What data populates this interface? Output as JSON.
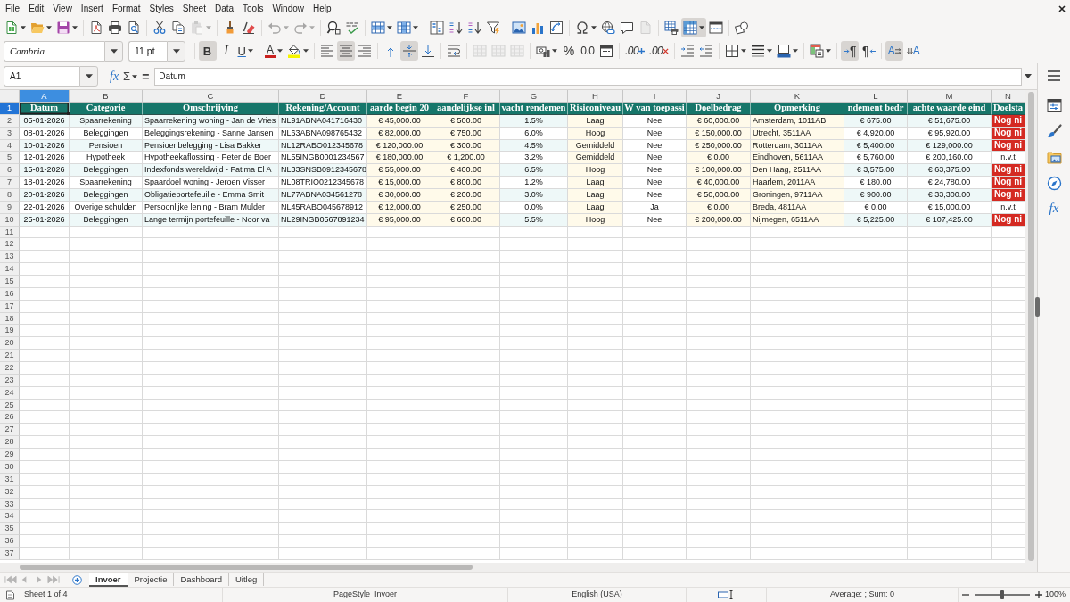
{
  "menu_bar": [
    "File",
    "Edit",
    "View",
    "Insert",
    "Format",
    "Styles",
    "Sheet",
    "Data",
    "Tools",
    "Window",
    "Help"
  ],
  "standard_toolbar": [
    {
      "pressed": false,
      "disabled": false
    },
    {
      "pressed": false,
      "disabled": false
    },
    {
      "pressed": false,
      "disabled": false
    },
    {
      "pressed": false,
      "disabled": false
    },
    {
      "pressed": false,
      "disabled": false
    },
    {
      "pressed": false,
      "disabled": false
    },
    {
      "pressed": false,
      "disabled": false
    },
    {
      "pressed": false,
      "disabled": false
    },
    {
      "pressed": false,
      "disabled": true
    },
    {
      "pressed": false,
      "disabled": false
    },
    {
      "pressed": false,
      "disabled": false
    },
    {
      "pressed": false,
      "disabled": true
    },
    {
      "pressed": false,
      "disabled": true
    },
    {
      "pressed": false,
      "disabled": false
    },
    {
      "pressed": false,
      "disabled": false
    },
    {
      "pressed": false,
      "disabled": false
    },
    {
      "pressed": false,
      "disabled": false
    },
    {
      "pressed": false,
      "disabled": false
    },
    {
      "pressed": false,
      "disabled": false
    },
    {
      "pressed": false,
      "disabled": false
    },
    {
      "pressed": false,
      "disabled": false
    },
    {
      "pressed": false,
      "disabled": false
    },
    {
      "pressed": false,
      "disabled": false
    },
    {
      "pressed": false,
      "disabled": false
    },
    {
      "pressed": false,
      "disabled": false
    },
    {
      "pressed": false,
      "disabled": false
    },
    {
      "pressed": false,
      "disabled": false
    },
    {
      "pressed": false,
      "disabled": true
    },
    {
      "pressed": false,
      "disabled": false
    },
    {
      "pressed": true,
      "disabled": false
    },
    {
      "pressed": false,
      "disabled": false
    },
    {
      "pressed": false,
      "disabled": false
    }
  ],
  "formatting_toolbar": {
    "font_name": "Cambria",
    "font_size": "11 pt",
    "buttons": [
      {
        "label": "B",
        "pressed": true,
        "disabled": false
      },
      {
        "label": "I",
        "pressed": false,
        "disabled": false
      },
      {
        "label": "U",
        "pressed": false,
        "disabled": false
      },
      {
        "label": "A",
        "pressed": false,
        "disabled": false
      },
      {
        "pressed": false,
        "disabled": false
      },
      {
        "pressed": false,
        "disabled": false
      },
      {
        "pressed": true,
        "disabled": false
      },
      {
        "pressed": false,
        "disabled": false
      },
      {
        "pressed": false,
        "disabled": false
      },
      {
        "pressed": true,
        "disabled": false
      },
      {
        "pressed": false,
        "disabled": false
      },
      {
        "pressed": false,
        "disabled": false
      },
      {
        "pressed": false,
        "disabled": true
      },
      {
        "pressed": false,
        "disabled": true
      },
      {
        "pressed": false,
        "disabled": true
      },
      {
        "pressed": false,
        "disabled": false
      },
      {
        "label": "%",
        "pressed": false,
        "disabled": false
      },
      {
        "label": "0.0",
        "pressed": false,
        "disabled": false
      },
      {
        "pressed": false,
        "disabled": false
      },
      {
        "label": ".00",
        "pressed": false,
        "disabled": false
      },
      {
        "label": ".00",
        "pressed": false,
        "disabled": false
      },
      {
        "pressed": false,
        "disabled": false
      },
      {
        "pressed": false,
        "disabled": false
      },
      {
        "pressed": false,
        "disabled": false
      },
      {
        "pressed": false,
        "disabled": false
      },
      {
        "pressed": false,
        "disabled": false
      },
      {
        "pressed": false,
        "disabled": false
      },
      {
        "label": "¶",
        "pressed": true,
        "disabled": false
      },
      {
        "label": "¶",
        "pressed": false,
        "disabled": false
      },
      {
        "label": "A",
        "pressed": true,
        "disabled": false
      },
      {
        "label": "A",
        "pressed": false,
        "disabled": false
      }
    ]
  },
  "formula_bar": {
    "cell_reference": "A1",
    "function_wizard": "fx",
    "sum_symbol": "Σ",
    "equals_symbol": "=",
    "content": "Datum"
  },
  "sidebar": {
    "functions_label": "fx"
  },
  "sheet": {
    "columns": [
      {
        "letter": "A",
        "selected": true,
        "kind": "banded"
      },
      {
        "letter": "B",
        "selected": false,
        "kind": "banded"
      },
      {
        "letter": "C",
        "selected": false,
        "kind": "banded"
      },
      {
        "letter": "D",
        "selected": false,
        "kind": "banded"
      },
      {
        "letter": "E",
        "selected": false,
        "kind": "input"
      },
      {
        "letter": "F",
        "selected": false,
        "kind": "input"
      },
      {
        "letter": "G",
        "selected": false,
        "kind": "banded"
      },
      {
        "letter": "H",
        "selected": false,
        "kind": "input"
      },
      {
        "letter": "I",
        "selected": false,
        "kind": "plain"
      },
      {
        "letter": "J",
        "selected": false,
        "kind": "input"
      },
      {
        "letter": "K",
        "selected": false,
        "kind": "input"
      },
      {
        "letter": "L",
        "selected": false,
        "kind": "banded"
      },
      {
        "letter": "M",
        "selected": false,
        "kind": "banded"
      },
      {
        "letter": "N",
        "selected": false,
        "kind": "plain"
      }
    ],
    "rows": [
      {
        "number": "1",
        "selected": true,
        "kind": "header",
        "cells": [
          "Datum",
          "Categorie",
          "Omschrijving",
          "Rekening/Account",
          "aarde begin 20",
          "aandelijkse inl",
          "vacht rendemen",
          "Risiconiveau",
          "W van toepassi",
          "Doelbedrag",
          "Opmerking",
          "ndement bedr",
          "achte waarde eind",
          "Doelsta"
        ]
      },
      {
        "number": "2",
        "selected": false,
        "kind": "data",
        "cells": [
          "05-01-2026",
          "Spaarrekening",
          "Spaarrekening woning - Jan de Vries",
          "NL91ABNA041716430",
          "€ 45,000.00",
          "€ 500.00",
          "1.5%",
          "Laag",
          "Nee",
          "€ 60,000.00",
          "Amsterdam, 1011AB",
          "€ 675.00",
          "€ 51,675.00",
          {
            "text": "Nog ni",
            "flagged": true
          }
        ]
      },
      {
        "number": "3",
        "selected": false,
        "kind": "data",
        "cells": [
          "08-01-2026",
          "Beleggingen",
          "Beleggingsrekening - Sanne Jansen",
          "NL63ABNA098765432",
          "€ 82,000.00",
          "€ 750.00",
          "6.0%",
          "Hoog",
          "Nee",
          "€ 150,000.00",
          "Utrecht, 3511AA",
          "€ 4,920.00",
          "€ 95,920.00",
          {
            "text": "Nog ni",
            "flagged": true
          }
        ]
      },
      {
        "number": "4",
        "selected": false,
        "kind": "data",
        "cells": [
          "10-01-2026",
          "Pensioen",
          "Pensioenbelegging - Lisa Bakker",
          "NL12RABO012345678",
          "€ 120,000.00",
          "€ 300.00",
          "4.5%",
          "Gemiddeld",
          "Nee",
          "€ 250,000.00",
          "Rotterdam, 3011AA",
          "€ 5,400.00",
          "€ 129,000.00",
          {
            "text": "Nog ni",
            "flagged": true
          }
        ]
      },
      {
        "number": "5",
        "selected": false,
        "kind": "data",
        "cells": [
          "12-01-2026",
          "Hypotheek",
          "Hypotheekaflossing - Peter de Boer",
          "NL55INGB0001234567",
          "€ 180,000.00",
          "€ 1,200.00",
          "3.2%",
          "Gemiddeld",
          "Nee",
          "€ 0.00",
          "Eindhoven, 5611AA",
          "€ 5,760.00",
          "€ 200,160.00",
          {
            "text": "n.v.t",
            "flagged": false
          }
        ]
      },
      {
        "number": "6",
        "selected": false,
        "kind": "data",
        "cells": [
          "15-01-2026",
          "Beleggingen",
          "Indexfonds wereldwijd - Fatima El A",
          "NL33SNSB0912345678",
          "€ 55,000.00",
          "€ 400.00",
          "6.5%",
          "Hoog",
          "Nee",
          "€ 100,000.00",
          "Den Haag, 2511AA",
          "€ 3,575.00",
          "€ 63,375.00",
          {
            "text": "Nog ni",
            "flagged": true
          }
        ]
      },
      {
        "number": "7",
        "selected": false,
        "kind": "data",
        "cells": [
          "18-01-2026",
          "Spaarrekening",
          "Spaardoel woning - Jeroen Visser",
          "NL08TRIO0212345678",
          "€ 15,000.00",
          "€ 800.00",
          "1.2%",
          "Laag",
          "Nee",
          "€ 40,000.00",
          "Haarlem, 2011AA",
          "€ 180.00",
          "€ 24,780.00",
          {
            "text": "Nog ni",
            "flagged": true
          }
        ]
      },
      {
        "number": "8",
        "selected": false,
        "kind": "data",
        "cells": [
          "20-01-2026",
          "Beleggingen",
          "Obligatieportefeuille - Emma Smit",
          "NL77ABNA034561278",
          "€ 30,000.00",
          "€ 200.00",
          "3.0%",
          "Laag",
          "Nee",
          "€ 50,000.00",
          "Groningen, 9711AA",
          "€ 900.00",
          "€ 33,300.00",
          {
            "text": "Nog ni",
            "flagged": true
          }
        ]
      },
      {
        "number": "9",
        "selected": false,
        "kind": "data",
        "cells": [
          "22-01-2026",
          "Overige schulden",
          "Persoonlijke lening - Bram Mulder",
          "NL45RABO045678912",
          "€ 12,000.00",
          "€ 250.00",
          "0.0%",
          "Laag",
          "Ja",
          "€ 0.00",
          "Breda, 4811AA",
          "€ 0.00",
          "€ 15,000.00",
          {
            "text": "n.v.t",
            "flagged": false
          }
        ]
      },
      {
        "number": "10",
        "selected": false,
        "kind": "data",
        "cells": [
          "25-01-2026",
          "Beleggingen",
          "Lange termijn portefeuille - Noor va",
          "NL29INGB0567891234",
          "€ 95,000.00",
          "€ 600.00",
          "5.5%",
          "Hoog",
          "Nee",
          "€ 200,000.00",
          "Nijmegen, 6511AA",
          "€ 5,225.00",
          "€ 107,425.00",
          {
            "text": "Nog ni",
            "flagged": true
          }
        ]
      },
      {
        "number": "11",
        "selected": false,
        "kind": "blank"
      },
      {
        "number": "12",
        "selected": false,
        "kind": "blank"
      },
      {
        "number": "13",
        "selected": false,
        "kind": "blank"
      },
      {
        "number": "14",
        "selected": false,
        "kind": "blank"
      },
      {
        "number": "15",
        "selected": false,
        "kind": "blank"
      },
      {
        "number": "16",
        "selected": false,
        "kind": "blank"
      },
      {
        "number": "17",
        "selected": false,
        "kind": "blank"
      },
      {
        "number": "18",
        "selected": false,
        "kind": "blank"
      },
      {
        "number": "19",
        "selected": false,
        "kind": "blank"
      },
      {
        "number": "20",
        "selected": false,
        "kind": "blank"
      },
      {
        "number": "21",
        "selected": false,
        "kind": "blank"
      },
      {
        "number": "22",
        "selected": false,
        "kind": "blank"
      },
      {
        "number": "23",
        "selected": false,
        "kind": "blank"
      },
      {
        "number": "24",
        "selected": false,
        "kind": "blank"
      },
      {
        "number": "25",
        "selected": false,
        "kind": "blank"
      },
      {
        "number": "26",
        "selected": false,
        "kind": "blank"
      },
      {
        "number": "27",
        "selected": false,
        "kind": "blank"
      },
      {
        "number": "28",
        "selected": false,
        "kind": "blank"
      },
      {
        "number": "29",
        "selected": false,
        "kind": "blank"
      },
      {
        "number": "30",
        "selected": false,
        "kind": "blank"
      },
      {
        "number": "31",
        "selected": false,
        "kind": "blank"
      },
      {
        "number": "32",
        "selected": false,
        "kind": "blank"
      },
      {
        "number": "33",
        "selected": false,
        "kind": "blank"
      },
      {
        "number": "34",
        "selected": false,
        "kind": "blank"
      },
      {
        "number": "35",
        "selected": false,
        "kind": "blank"
      },
      {
        "number": "36",
        "selected": false,
        "kind": "blank"
      },
      {
        "number": "37",
        "selected": false,
        "kind": "blank"
      }
    ]
  },
  "sheet_tabs": [
    {
      "label": "Invoer",
      "selected": true
    },
    {
      "label": "Projectie",
      "selected": false
    },
    {
      "label": "Dashboard",
      "selected": false
    },
    {
      "label": "Uitleg",
      "selected": false
    }
  ],
  "status_bar": {
    "sheet_position": "Sheet 1 of 4",
    "page_style": "PageStyle_Invoer",
    "language": "English (USA)",
    "selection_summary": "Average: ; Sum: 0",
    "zoom": {
      "level": 0.5,
      "reading": "100%"
    }
  }
}
